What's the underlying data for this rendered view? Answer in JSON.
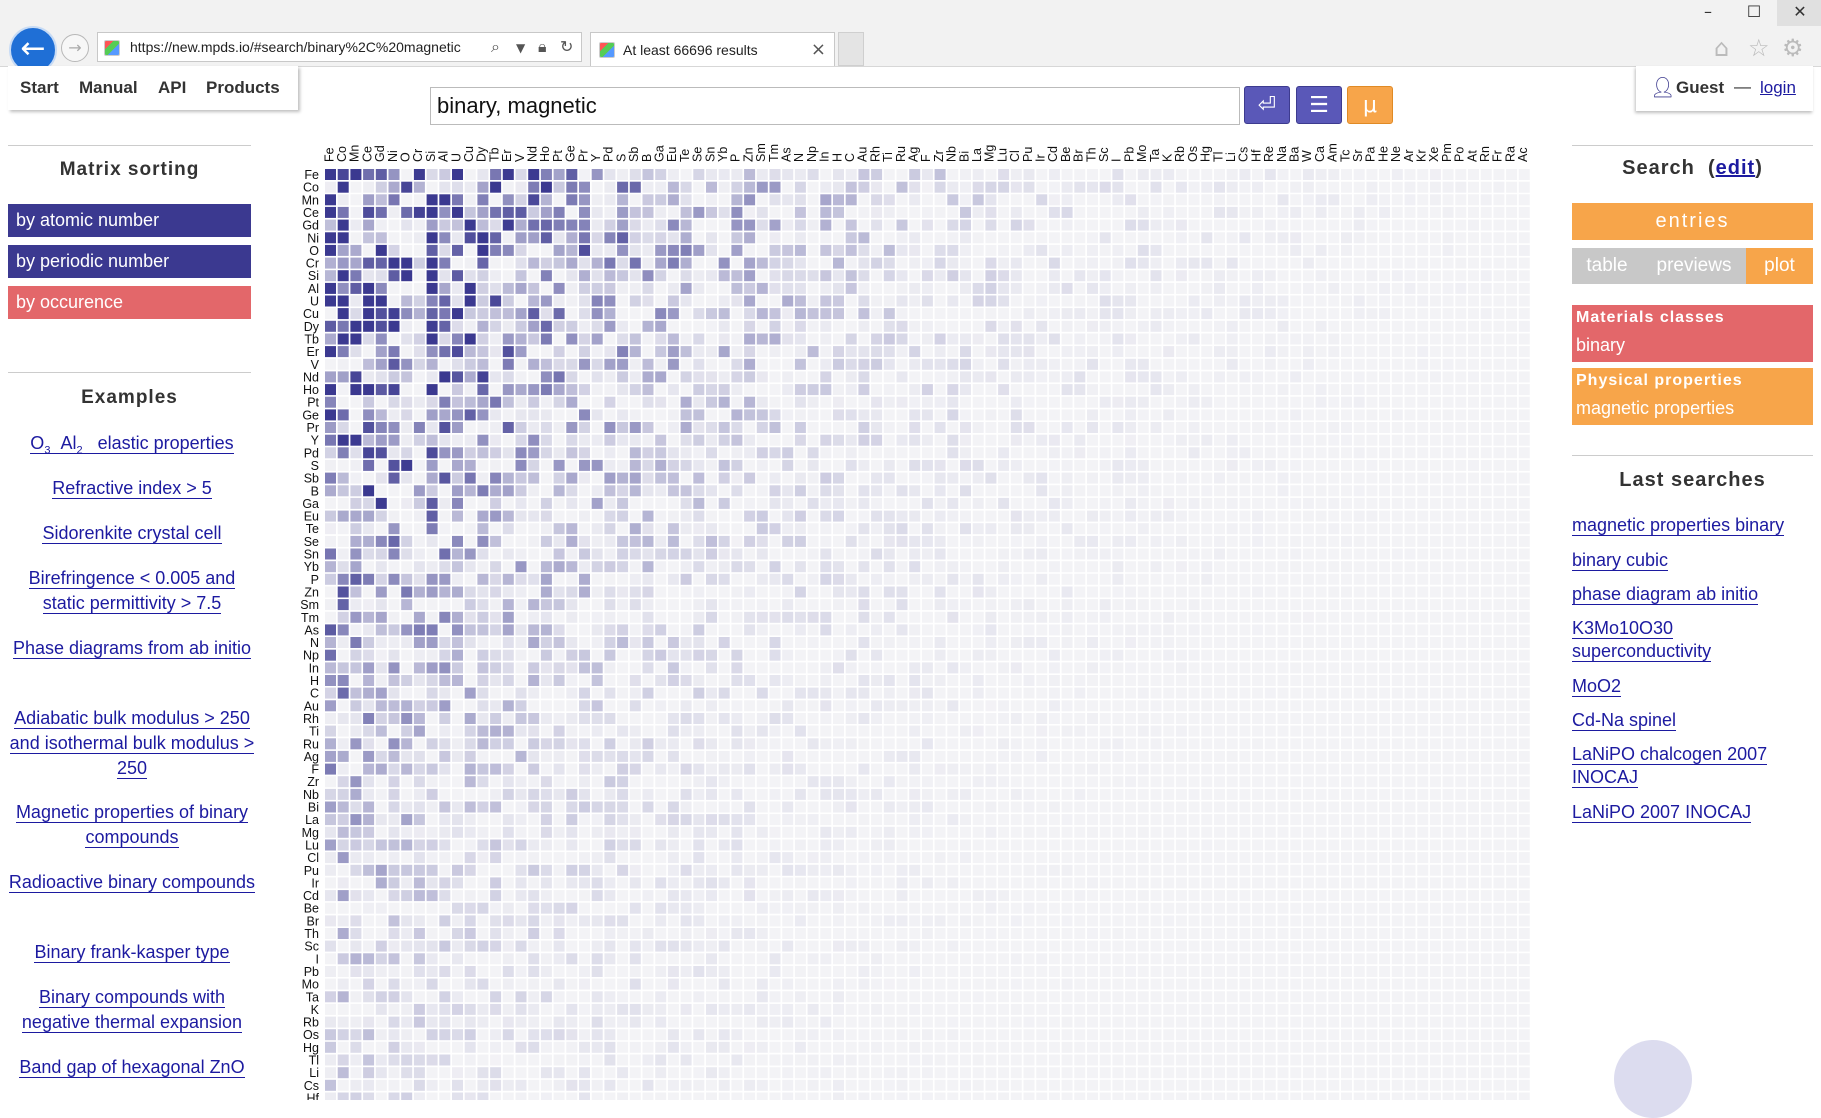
{
  "browser": {
    "address": "https://new.mpds.io/#search/binary%2C%20magnetic",
    "tab_title": "At least 66696 results",
    "tab_close": "×"
  },
  "nav": {
    "start": "Start",
    "manual": "Manual",
    "api": "API",
    "products": "Products"
  },
  "search": {
    "query": "binary, magnetic"
  },
  "user": {
    "name": "Guest",
    "dash": "—",
    "login": "login"
  },
  "sorting": {
    "title": "Matrix sorting",
    "options": [
      "by atomic number",
      "by periodic number",
      "by occurence"
    ]
  },
  "examples": {
    "title": "Examples",
    "items": [
      "elastic properties",
      "Refractive index > 5",
      "Sidorenkite crystal cell",
      "Birefringence < 0.005 and static permittivity > 7.5",
      "Phase diagrams from ab initio",
      "Adiabatic bulk modulus > 250 and isothermal bulk modulus > 250",
      "Magnetic properties of binary compounds",
      "Radioactive binary compounds",
      "Binary frank-kasper type",
      "Binary compounds with negative thermal expansion",
      "Band gap of hexagonal ZnO"
    ],
    "formula": {
      "o": "O",
      "o_sub": "3",
      "al": "Al",
      "al_sub": "2"
    }
  },
  "right": {
    "search_title": "Search",
    "edit": "edit",
    "entries": "entries",
    "views": {
      "table": "table",
      "previews": "previews",
      "plot": "plot"
    },
    "facets": [
      {
        "title": "Materials classes",
        "value": "binary"
      },
      {
        "title": "Physical properties",
        "value": "magnetic properties"
      }
    ],
    "last_title": "Last searches",
    "last": [
      "magnetic properties binary",
      "binary cubic",
      "phase diagram ab initio",
      "K3Mo10O30 superconductivity",
      "MoO2",
      "Cd-Na spinel",
      "LaNiPO chalcogen 2007 INOCAJ",
      "LaNiPO 2007 INOCAJ"
    ]
  },
  "matrix": {
    "x_elements": [
      "Fe",
      "Co",
      "Mn",
      "Ce",
      "Gd",
      "Ni",
      "O",
      "Cr",
      "Si",
      "Al",
      "U",
      "Cu",
      "Dy",
      "Tb",
      "Er",
      "V",
      "Nd",
      "Ho",
      "Pt",
      "Ge",
      "Pr",
      "Y",
      "Pd",
      "S",
      "Sb",
      "B",
      "Ga",
      "Eu",
      "Te",
      "Se",
      "Sn",
      "Yb",
      "P",
      "Zn",
      "Sm",
      "Tm",
      "As",
      "N",
      "Np",
      "In",
      "H",
      "C",
      "Au",
      "Rh",
      "Ti",
      "Ru",
      "Ag",
      "F",
      "Zr",
      "Nb",
      "Bi",
      "La",
      "Mg",
      "Lu",
      "Cl",
      "Pu",
      "Ir",
      "Cd",
      "Be",
      "Br",
      "Th",
      "Sc",
      "I",
      "Pb",
      "Mo",
      "Ta",
      "K",
      "Rb",
      "Os",
      "Hg",
      "Tl",
      "Li",
      "Cs",
      "Hf",
      "Re",
      "Na",
      "Ba",
      "W",
      "Ca",
      "Am",
      "Tc",
      "Sr",
      "Pa",
      "He",
      "Ne",
      "Ar",
      "Kr",
      "Xe",
      "Pm",
      "Po",
      "At",
      "Rn",
      "Fr",
      "Ra",
      "Ac"
    ],
    "y_elements": [
      "Fe",
      "Co",
      "Mn",
      "Ce",
      "Gd",
      "Ni",
      "O",
      "Cr",
      "Si",
      "Al",
      "U",
      "Cu",
      "Dy",
      "Tb",
      "Er",
      "V",
      "Nd",
      "Ho",
      "Pt",
      "Ge",
      "Pr",
      "Y",
      "Pd",
      "S",
      "Sb",
      "B",
      "Ga",
      "Eu",
      "Te",
      "Se",
      "Sn",
      "Yb",
      "P",
      "Zn",
      "Sm",
      "Tm",
      "As",
      "N",
      "Np",
      "In",
      "H",
      "C",
      "Au",
      "Rh",
      "Ti",
      "Ru",
      "Ag",
      "F",
      "Zr",
      "Nb",
      "Bi",
      "La",
      "Mg",
      "Lu",
      "Cl",
      "Pu",
      "Ir",
      "Cd",
      "Be",
      "Br",
      "Th",
      "Sc",
      "I",
      "Pb",
      "Mo",
      "Ta",
      "K",
      "Rb",
      "Os",
      "Hg",
      "Tl",
      "Li",
      "Cs",
      "Hf"
    ],
    "colors": {
      "max": "#3b3990",
      "min": "#f3f3f6"
    }
  }
}
